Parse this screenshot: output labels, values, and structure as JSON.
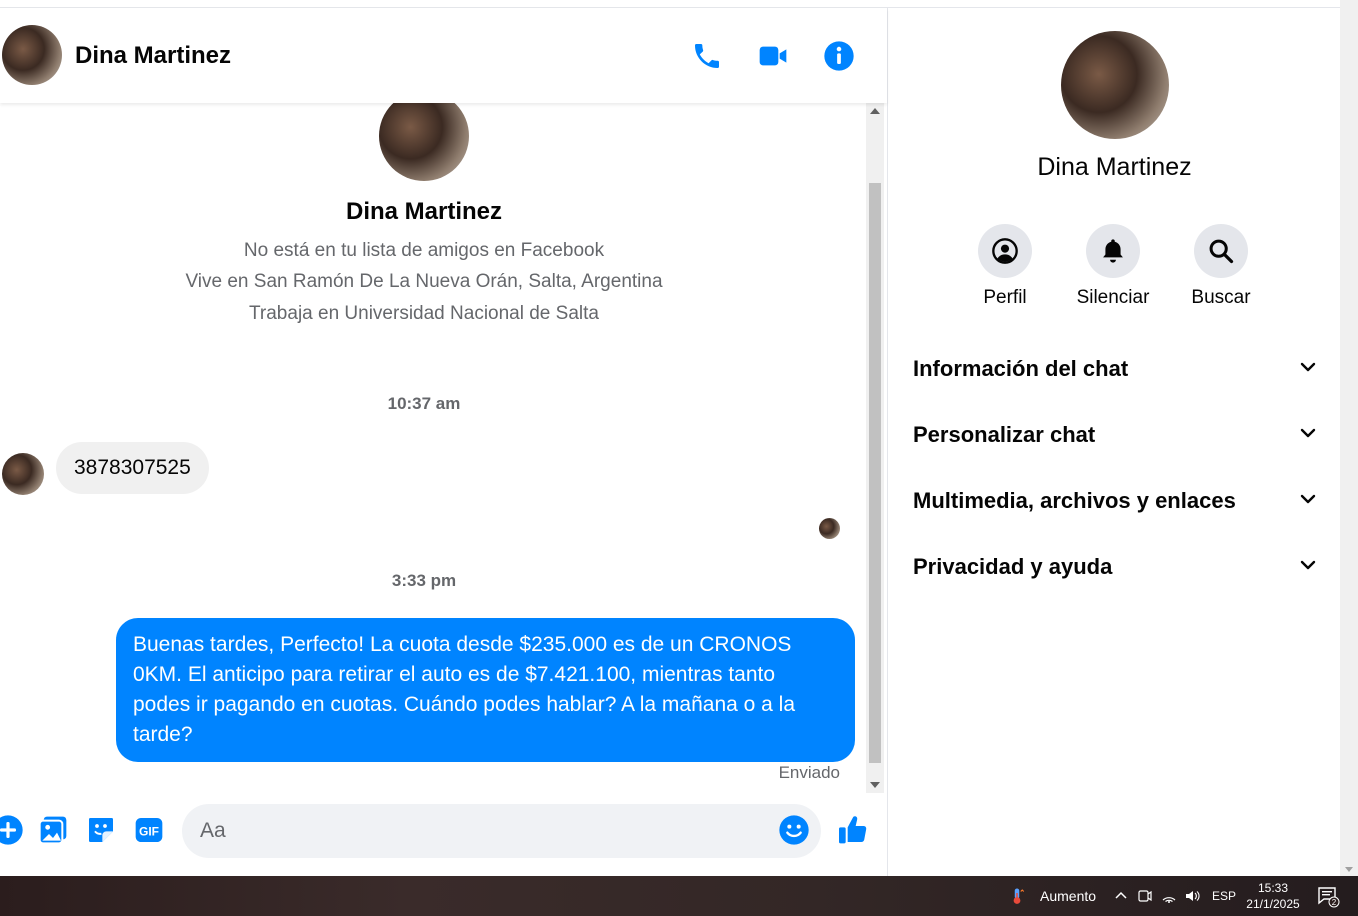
{
  "header": {
    "contact_name": "Dina Martinez",
    "icons": [
      "phone-icon",
      "video-icon",
      "info-icon"
    ]
  },
  "profile_intro": {
    "name": "Dina Martinez",
    "lines": [
      "No está en tu lista de amigos en Facebook",
      "Vive en San Ramón De La Nueva Orán, Salta, Argentina",
      "Trabaja en Universidad Nacional de Salta"
    ]
  },
  "messages": [
    {
      "type": "timestamp",
      "text": "10:37 am"
    },
    {
      "type": "incoming",
      "text": "3878307525"
    },
    {
      "type": "timestamp",
      "text": "3:33 pm"
    },
    {
      "type": "outgoing",
      "text": "Buenas tardes, Perfecto! La cuota desde $235.000 es de un CRONOS 0KM. El anticipo para retirar el auto es de $7.421.100, mientras tanto podes ir pagando en cuotas. Cuándo podes hablar? A la mañana o a la tarde?",
      "status": "Enviado"
    }
  ],
  "composer": {
    "placeholder": "Aa",
    "icons": [
      "plus-icon",
      "image-icon",
      "sticker-icon",
      "gif-icon",
      "emoji-icon",
      "like-icon"
    ],
    "gif_label": "GIF"
  },
  "right_panel": {
    "name": "Dina Martinez",
    "actions": [
      {
        "label": "Perfil",
        "icon": "profile-icon"
      },
      {
        "label": "Silenciar",
        "icon": "bell-icon"
      },
      {
        "label": "Buscar",
        "icon": "search-icon"
      }
    ],
    "sections": [
      "Información del chat",
      "Personalizar chat",
      "Multimedia, archivos y enlaces",
      "Privacidad y ayuda"
    ]
  },
  "taskbar": {
    "weather": "Aumento",
    "language": "ESP",
    "time": "15:33",
    "date": "21/1/2025",
    "notifications": "2"
  },
  "colors": {
    "accent": "#0084ff",
    "incoming_bubble": "#f0f0f0",
    "secondary_text": "#65676b"
  }
}
